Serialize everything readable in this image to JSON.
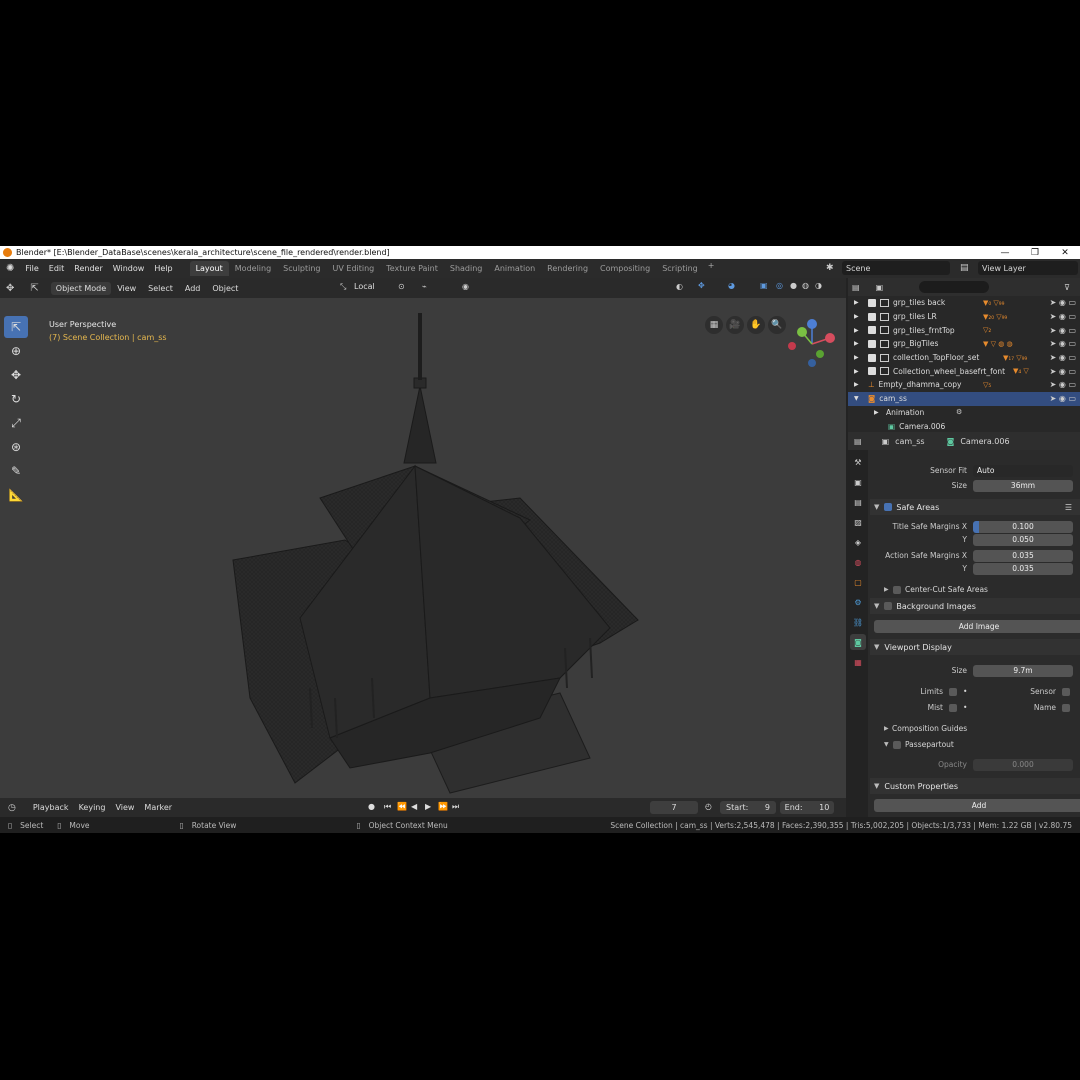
{
  "window": {
    "title": "Blender* [E:\\Blender_DataBase\\scenes\\kerala_architecture\\scene_file_rendered\\render.blend]",
    "min": "—",
    "max": "❐",
    "close": "✕"
  },
  "menu": [
    "File",
    "Edit",
    "Render",
    "Window",
    "Help"
  ],
  "workspaces": [
    "Layout",
    "Modeling",
    "Sculpting",
    "UV Editing",
    "Texture Paint",
    "Shading",
    "Animation",
    "Rendering",
    "Compositing",
    "Scripting"
  ],
  "scene": "Scene",
  "view_layer": "View Layer",
  "viewport_header": {
    "mode": "Object Mode",
    "items": [
      "View",
      "Select",
      "Add",
      "Object"
    ],
    "orientation": "Local"
  },
  "viewport": {
    "perspective": "User Perspective",
    "collection": "(7) Scene Collection | cam_ss"
  },
  "outliner": {
    "rows": [
      {
        "name": "grp_tiles back",
        "selected": false,
        "checkbox": true
      },
      {
        "name": "grp_tiles LR",
        "selected": false,
        "checkbox": true
      },
      {
        "name": "grp_tiles_frntTop",
        "selected": false,
        "checkbox": true
      },
      {
        "name": "grp_BigTiles",
        "selected": false,
        "checkbox": true
      },
      {
        "name": "collection_TopFloor_set",
        "selected": false,
        "checkbox": true
      },
      {
        "name": "Collection_wheel_basefrt_font",
        "selected": false,
        "checkbox": true
      },
      {
        "name": "Empty_dhamma_copy",
        "selected": false,
        "checkbox": false
      },
      {
        "name": "cam_ss",
        "selected": true,
        "checkbox": false
      },
      {
        "name": "Animation",
        "selected": false,
        "checkbox": false
      },
      {
        "name": "Camera.006",
        "selected": false,
        "checkbox": false
      }
    ]
  },
  "properties": {
    "object": "cam_ss",
    "data": "Camera.006",
    "sensor_fit_label": "Sensor Fit",
    "sensor_fit_value": "Auto",
    "size_label": "Size",
    "size_value": "36mm",
    "safe_areas": "Safe Areas",
    "title_safe_label": "Title Safe Margins X",
    "title_safe_x": "0.100",
    "y_label": "Y",
    "title_safe_y": "0.050",
    "action_safe_label": "Action Safe Margins X",
    "action_safe_x": "0.035",
    "action_safe_y": "0.035",
    "center_cut": "Center-Cut Safe Areas",
    "background_images": "Background Images",
    "add_image": "Add Image",
    "viewport_display": "Viewport Display",
    "vd_size_label": "Size",
    "vd_size_value": "9.7m",
    "limits": "Limits",
    "sensor": "Sensor",
    "mist": "Mist",
    "name": "Name",
    "composition_guides": "Composition Guides",
    "passepartout": "Passepartout",
    "opacity_label": "Opacity",
    "opacity_value": "0.000",
    "custom_properties": "Custom Properties",
    "add": "Add"
  },
  "timeline": {
    "items": [
      "Playback",
      "Keying",
      "View",
      "Marker"
    ],
    "frame": "7",
    "start_label": "Start:",
    "start": "9",
    "end_label": "End:",
    "end": "10"
  },
  "status": {
    "select": "Select",
    "move": "Move",
    "rotate": "Rotate View",
    "context": "Object Context Menu",
    "stats": "Scene Collection | cam_ss | Verts:2,545,478 | Faces:2,390,355 | Tris:5,002,205 | Objects:1/3,733 | Mem: 1.22 GB | v2.80.75"
  }
}
